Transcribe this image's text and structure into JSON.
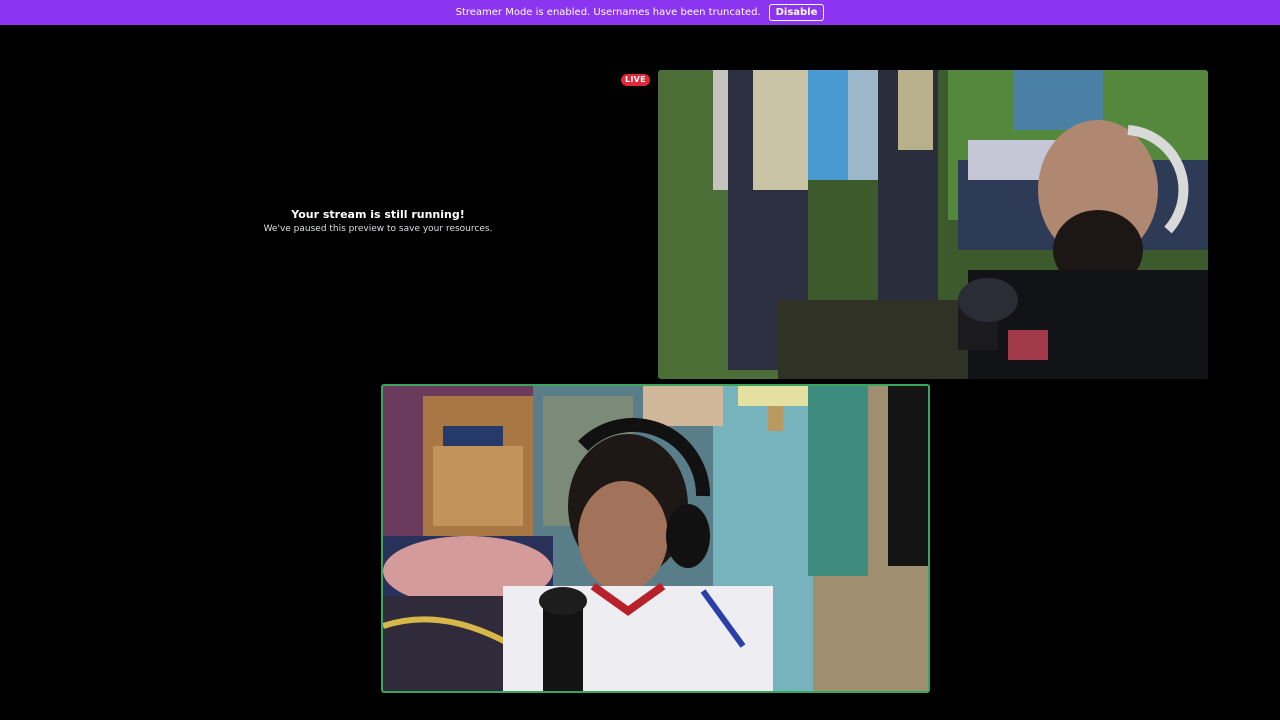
{
  "banner": {
    "text": "Streamer Mode is enabled. Usernames have been truncated.",
    "disable_label": "Disable",
    "color": "#8c35f0"
  },
  "stream": {
    "live_label": "LIVE",
    "paused_title": "Your stream is still running!",
    "paused_subtitle": "We've paused this preview to save your resources."
  },
  "participants": [
    {
      "id": "participant-a",
      "speaking": false
    },
    {
      "id": "participant-b",
      "speaking": true,
      "speaking_color": "#3ba55d"
    }
  ]
}
